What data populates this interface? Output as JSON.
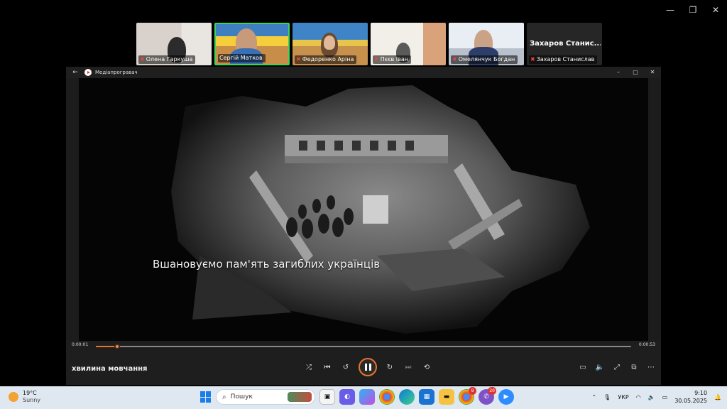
{
  "participants": [
    {
      "name": "Олена Гаркуша",
      "active": false
    },
    {
      "name": "Сергій Матков",
      "active": true
    },
    {
      "name": "Федоренко Аріна",
      "active": false
    },
    {
      "name": "Пєєв Іван",
      "active": false
    },
    {
      "name": "Омелянчук Богдан",
      "active": false
    },
    {
      "name": "Захаров Станислав",
      "big_name": "Захаров Станис...",
      "active": false
    }
  ],
  "player": {
    "app_title": "Медіапрогравач",
    "caption": "Вшановуємо пам'ять загиблих українців",
    "current_time": "0:00:01",
    "total_time": "0:00:53",
    "progress": 0.04,
    "media_title": "хвилина мовчання"
  },
  "taskbar": {
    "weather_temp": "19°C",
    "weather_cond": "Sunny",
    "search_placeholder": "Пошук",
    "badge_chrome": "9",
    "badge_viber": "20",
    "language": "УКР",
    "time": "9:10",
    "date": "30.05.2025"
  },
  "colors": {
    "accent": "#e8752c",
    "active_border": "#3fd35a",
    "mic_off": "#e8453c",
    "taskbar_bg": "#dfe8f0"
  }
}
